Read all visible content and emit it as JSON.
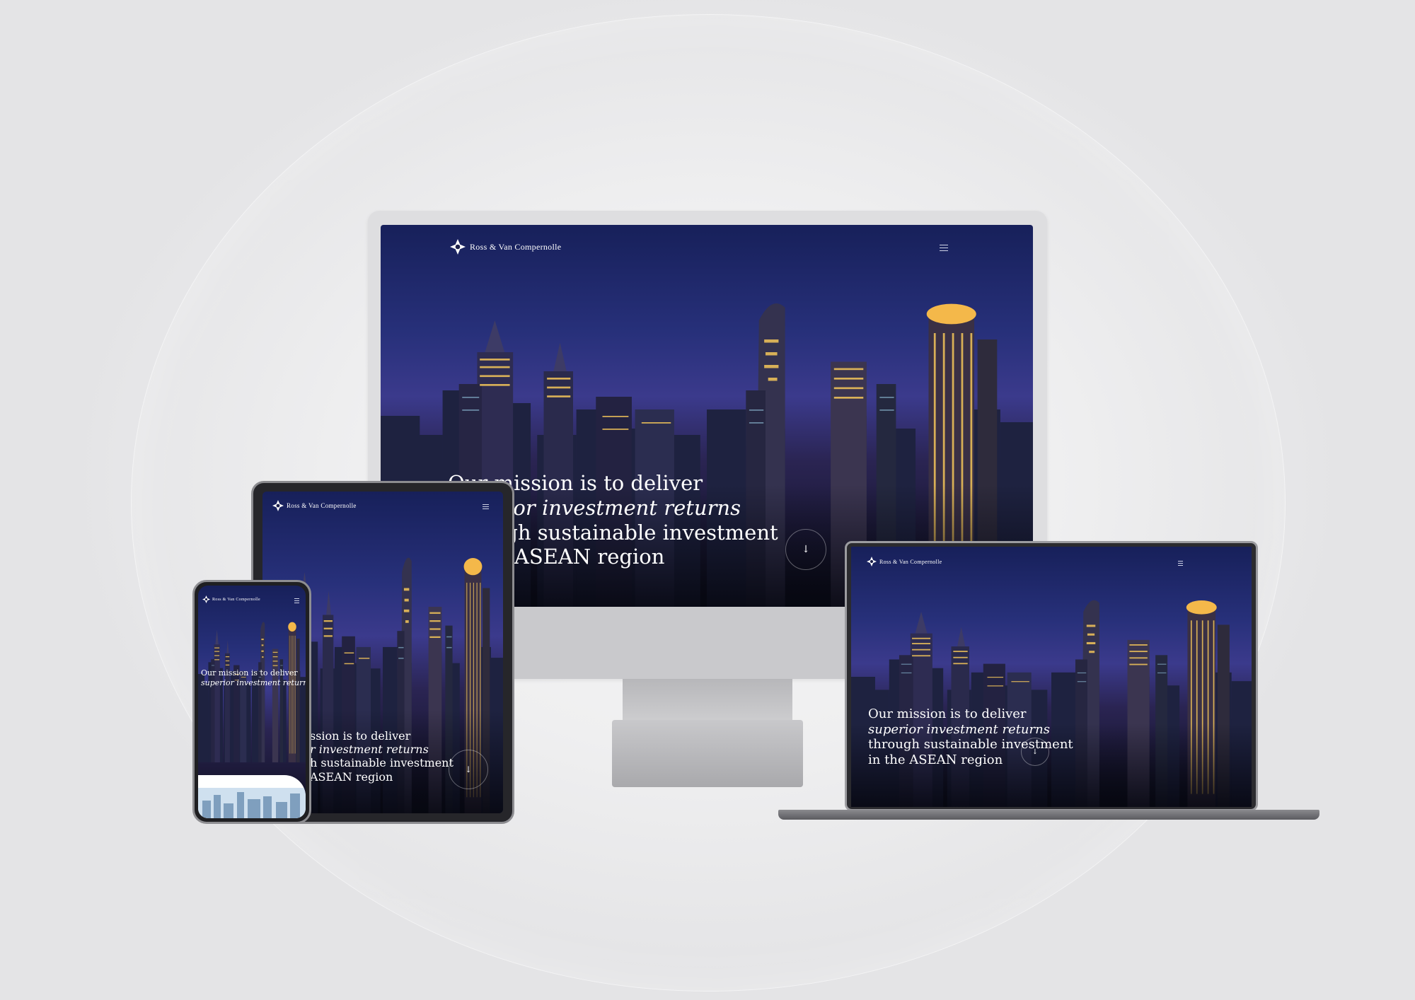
{
  "brand": {
    "name": "Ross & Van Compernolle"
  },
  "hero": {
    "line1": "Our mission is to deliver",
    "line2": "superior investment returns",
    "line3": "through sustainable investment",
    "line4": "in the ASEAN region"
  },
  "tablet_hero": {
    "line1": "ssion is to deliver",
    "line2": "r investment returns",
    "line3": "h sustainable investment",
    "line4": "ASEAN region"
  },
  "phone_hero": {
    "line1": "Our mission is to deliver",
    "line2": "superior investment returns"
  },
  "icons": {
    "logo": "compass-star-icon",
    "menu": "hamburger-menu-icon",
    "scroll": "arrow-down-icon"
  },
  "scroll_glyph": "↓",
  "colors": {
    "sky_top": "#17205a",
    "sky_mid": "#3b3a8c",
    "ground": "#0d0e1c",
    "accent_light": "#f4c65a"
  }
}
